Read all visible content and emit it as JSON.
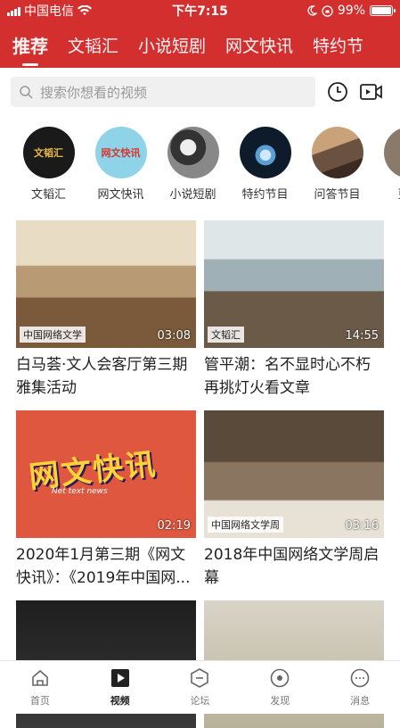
{
  "status": {
    "carrier": "中国电信",
    "time": "下午7:15",
    "battery": "99%",
    "battery_level": 0.99
  },
  "tabs": [
    "推荐",
    "文韬汇",
    "小说短剧",
    "网文快讯",
    "特约节"
  ],
  "search": {
    "placeholder": "搜索你想看的视频"
  },
  "channels": [
    {
      "label": "文韬汇",
      "art": "文韬汇",
      "bg": "#1a1a1a",
      "fg": "#e6b84a"
    },
    {
      "label": "网文快讯",
      "art": "网文快讯",
      "bg": "#8fd3e8",
      "fg": "#d7342c"
    },
    {
      "label": "小说短剧",
      "art": "",
      "bg": "#555555",
      "fg": "#ffffff"
    },
    {
      "label": "特约节目",
      "art": "",
      "bg": "#0d1b2a",
      "fg": "#ffffff"
    },
    {
      "label": "问答节目",
      "art": "",
      "bg": "#6b5240",
      "fg": "#ffffff"
    },
    {
      "label": "更多",
      "art": "",
      "bg": "#8a7a6a",
      "fg": "#ffffff"
    }
  ],
  "videos": [
    {
      "title": "白马荟·文人会客厅第三期雅集活动",
      "duration": "03:08",
      "caption": "中国网络文学"
    },
    {
      "title": "管平潮：名不显时心不朽再挑灯火看文章",
      "duration": "14:55",
      "caption": "文韬汇"
    },
    {
      "title": "2020年1月第三期《网文快讯》：《2019年中国网...",
      "duration": "02:19",
      "caption": "网文快讯",
      "subcaption": "Net text news"
    },
    {
      "title": "2018年中国网络文学周启幕",
      "duration": "03:16",
      "caption": "中国网络文学周"
    },
    {
      "title": "",
      "duration": "",
      "caption": ""
    },
    {
      "title": "",
      "duration": "",
      "caption": ""
    }
  ],
  "bottomnav": [
    {
      "label": "首页",
      "icon": "home-icon"
    },
    {
      "label": "视频",
      "icon": "video-play-icon"
    },
    {
      "label": "论坛",
      "icon": "forum-icon"
    },
    {
      "label": "发现",
      "icon": "discover-icon"
    },
    {
      "label": "消息",
      "icon": "message-icon"
    }
  ],
  "colors": {
    "brand_red": "#d32f2f"
  }
}
